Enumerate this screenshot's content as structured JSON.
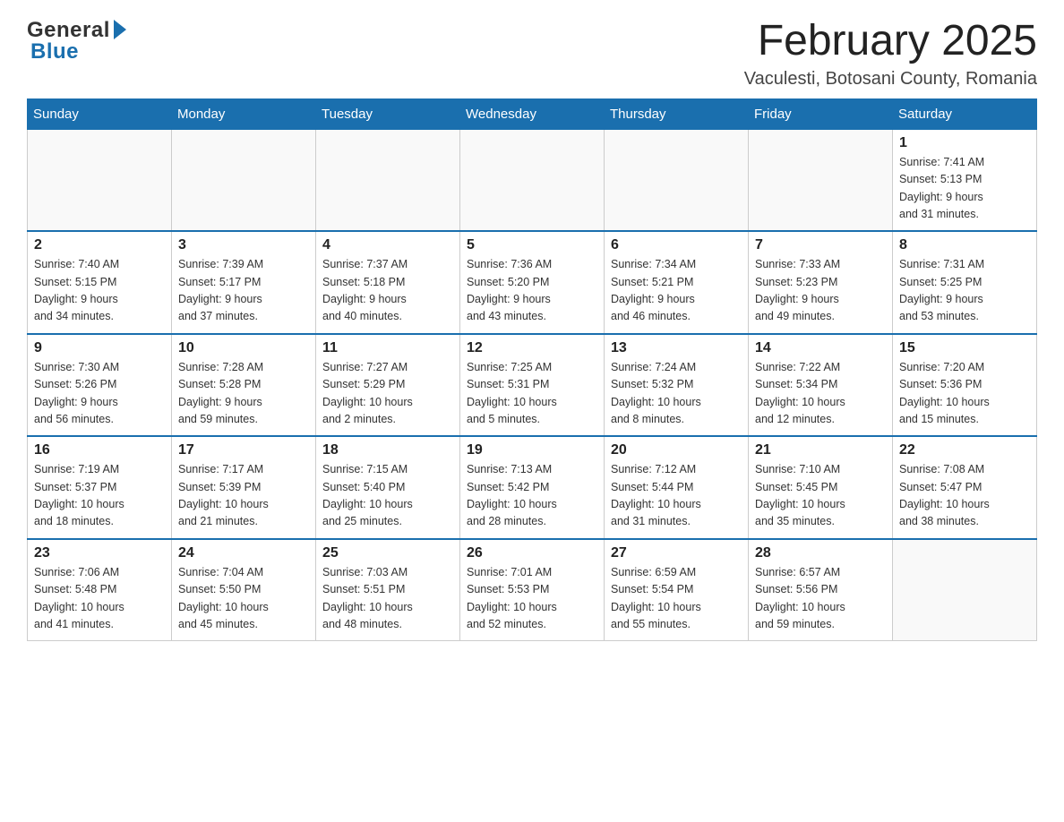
{
  "header": {
    "logo_general": "General",
    "logo_blue": "Blue",
    "month_title": "February 2025",
    "location": "Vaculesti, Botosani County, Romania"
  },
  "days_of_week": [
    "Sunday",
    "Monday",
    "Tuesday",
    "Wednesday",
    "Thursday",
    "Friday",
    "Saturday"
  ],
  "weeks": [
    [
      {
        "date": "",
        "info": ""
      },
      {
        "date": "",
        "info": ""
      },
      {
        "date": "",
        "info": ""
      },
      {
        "date": "",
        "info": ""
      },
      {
        "date": "",
        "info": ""
      },
      {
        "date": "",
        "info": ""
      },
      {
        "date": "1",
        "info": "Sunrise: 7:41 AM\nSunset: 5:13 PM\nDaylight: 9 hours\nand 31 minutes."
      }
    ],
    [
      {
        "date": "2",
        "info": "Sunrise: 7:40 AM\nSunset: 5:15 PM\nDaylight: 9 hours\nand 34 minutes."
      },
      {
        "date": "3",
        "info": "Sunrise: 7:39 AM\nSunset: 5:17 PM\nDaylight: 9 hours\nand 37 minutes."
      },
      {
        "date": "4",
        "info": "Sunrise: 7:37 AM\nSunset: 5:18 PM\nDaylight: 9 hours\nand 40 minutes."
      },
      {
        "date": "5",
        "info": "Sunrise: 7:36 AM\nSunset: 5:20 PM\nDaylight: 9 hours\nand 43 minutes."
      },
      {
        "date": "6",
        "info": "Sunrise: 7:34 AM\nSunset: 5:21 PM\nDaylight: 9 hours\nand 46 minutes."
      },
      {
        "date": "7",
        "info": "Sunrise: 7:33 AM\nSunset: 5:23 PM\nDaylight: 9 hours\nand 49 minutes."
      },
      {
        "date": "8",
        "info": "Sunrise: 7:31 AM\nSunset: 5:25 PM\nDaylight: 9 hours\nand 53 minutes."
      }
    ],
    [
      {
        "date": "9",
        "info": "Sunrise: 7:30 AM\nSunset: 5:26 PM\nDaylight: 9 hours\nand 56 minutes."
      },
      {
        "date": "10",
        "info": "Sunrise: 7:28 AM\nSunset: 5:28 PM\nDaylight: 9 hours\nand 59 minutes."
      },
      {
        "date": "11",
        "info": "Sunrise: 7:27 AM\nSunset: 5:29 PM\nDaylight: 10 hours\nand 2 minutes."
      },
      {
        "date": "12",
        "info": "Sunrise: 7:25 AM\nSunset: 5:31 PM\nDaylight: 10 hours\nand 5 minutes."
      },
      {
        "date": "13",
        "info": "Sunrise: 7:24 AM\nSunset: 5:32 PM\nDaylight: 10 hours\nand 8 minutes."
      },
      {
        "date": "14",
        "info": "Sunrise: 7:22 AM\nSunset: 5:34 PM\nDaylight: 10 hours\nand 12 minutes."
      },
      {
        "date": "15",
        "info": "Sunrise: 7:20 AM\nSunset: 5:36 PM\nDaylight: 10 hours\nand 15 minutes."
      }
    ],
    [
      {
        "date": "16",
        "info": "Sunrise: 7:19 AM\nSunset: 5:37 PM\nDaylight: 10 hours\nand 18 minutes."
      },
      {
        "date": "17",
        "info": "Sunrise: 7:17 AM\nSunset: 5:39 PM\nDaylight: 10 hours\nand 21 minutes."
      },
      {
        "date": "18",
        "info": "Sunrise: 7:15 AM\nSunset: 5:40 PM\nDaylight: 10 hours\nand 25 minutes."
      },
      {
        "date": "19",
        "info": "Sunrise: 7:13 AM\nSunset: 5:42 PM\nDaylight: 10 hours\nand 28 minutes."
      },
      {
        "date": "20",
        "info": "Sunrise: 7:12 AM\nSunset: 5:44 PM\nDaylight: 10 hours\nand 31 minutes."
      },
      {
        "date": "21",
        "info": "Sunrise: 7:10 AM\nSunset: 5:45 PM\nDaylight: 10 hours\nand 35 minutes."
      },
      {
        "date": "22",
        "info": "Sunrise: 7:08 AM\nSunset: 5:47 PM\nDaylight: 10 hours\nand 38 minutes."
      }
    ],
    [
      {
        "date": "23",
        "info": "Sunrise: 7:06 AM\nSunset: 5:48 PM\nDaylight: 10 hours\nand 41 minutes."
      },
      {
        "date": "24",
        "info": "Sunrise: 7:04 AM\nSunset: 5:50 PM\nDaylight: 10 hours\nand 45 minutes."
      },
      {
        "date": "25",
        "info": "Sunrise: 7:03 AM\nSunset: 5:51 PM\nDaylight: 10 hours\nand 48 minutes."
      },
      {
        "date": "26",
        "info": "Sunrise: 7:01 AM\nSunset: 5:53 PM\nDaylight: 10 hours\nand 52 minutes."
      },
      {
        "date": "27",
        "info": "Sunrise: 6:59 AM\nSunset: 5:54 PM\nDaylight: 10 hours\nand 55 minutes."
      },
      {
        "date": "28",
        "info": "Sunrise: 6:57 AM\nSunset: 5:56 PM\nDaylight: 10 hours\nand 59 minutes."
      },
      {
        "date": "",
        "info": ""
      }
    ]
  ]
}
